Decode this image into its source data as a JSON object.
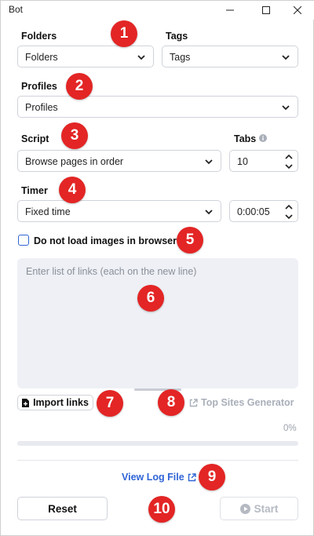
{
  "window": {
    "title": "Bot"
  },
  "folders": {
    "label": "Folders",
    "value": "Folders"
  },
  "tags": {
    "label": "Tags",
    "value": "Tags"
  },
  "profiles": {
    "label": "Profiles",
    "value": "Profiles"
  },
  "script": {
    "label": "Script",
    "value": "Browse pages in order"
  },
  "tabs": {
    "label": "Tabs",
    "value": "10"
  },
  "timer": {
    "label": "Timer",
    "value": "Fixed time",
    "duration": "0:00:05"
  },
  "images_option": {
    "label": "Do not load images in browser",
    "checked": false
  },
  "links": {
    "placeholder": "Enter list of links (each on the new line)"
  },
  "import_button": {
    "label": "Import links"
  },
  "top_sites": {
    "label": "Top Sites Generator"
  },
  "progress": {
    "percent_text": "0%",
    "value": 0
  },
  "view_log": {
    "label": "View Log File"
  },
  "reset_button": {
    "label": "Reset"
  },
  "start_button": {
    "label": "Start"
  },
  "markers": [
    "1",
    "2",
    "3",
    "4",
    "5",
    "6",
    "7",
    "8",
    "9",
    "10"
  ],
  "colors": {
    "accent": "#2f64d6",
    "marker": "#e32525",
    "textarea_bg": "#eef0f5"
  },
  "icons": {
    "select_arrow": "chevron-down-icon",
    "spin": "spin-arrows-icon",
    "info": "info-icon",
    "import": "document-icon",
    "external": "external-link-icon",
    "play": "play-circle-icon"
  }
}
